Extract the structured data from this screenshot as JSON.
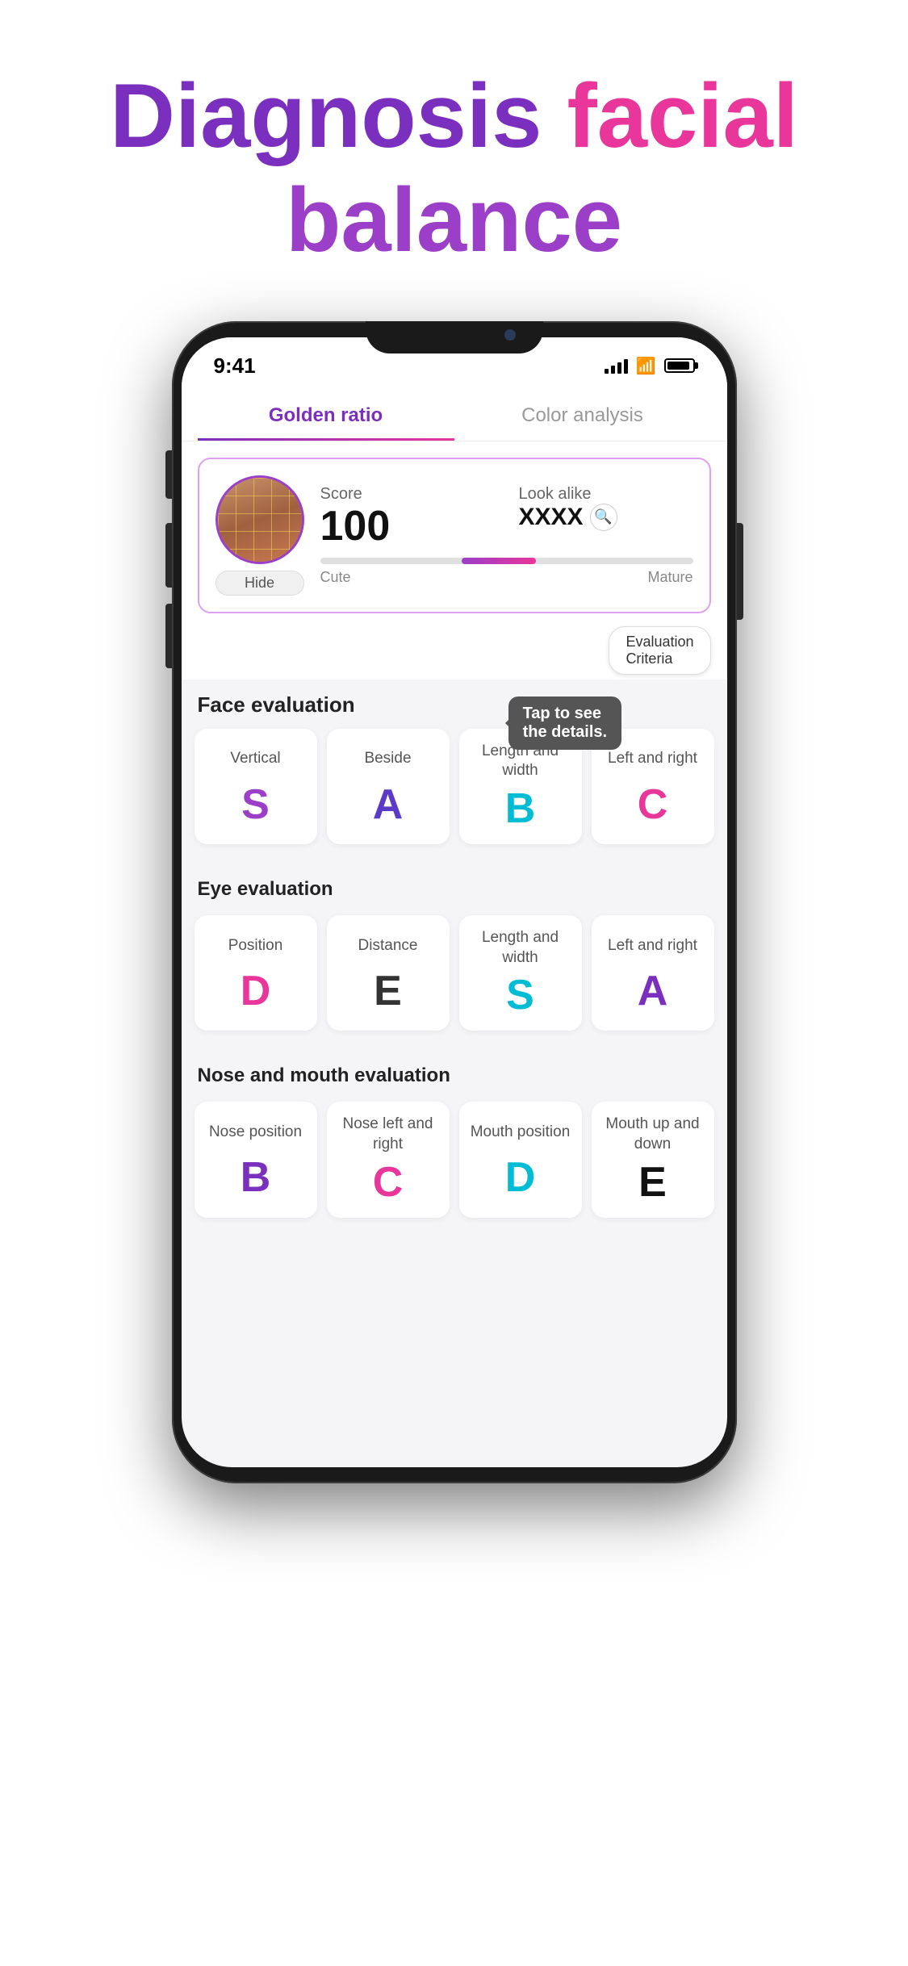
{
  "header": {
    "line1_part1": "Diagnosis ",
    "line1_part2": "facial",
    "line2": "balance"
  },
  "status_bar": {
    "time": "9:41",
    "signal_bars": [
      6,
      10,
      14,
      18
    ],
    "wifi": "wifi",
    "battery": "battery"
  },
  "tabs": [
    {
      "label": "Golden ratio",
      "active": true
    },
    {
      "label": "Color analysis",
      "active": false
    }
  ],
  "score_card": {
    "score_label": "Score",
    "score_value": "100",
    "look_alike_label": "Look alike",
    "look_alike_value": "XXXX",
    "hide_button": "Hide",
    "bar_label_left": "Cute",
    "bar_label_right": "Mature"
  },
  "eval_criteria_button": "Evaluation\nCriteria",
  "tooltip": "Tap to see\nthe details.",
  "face_evaluation": {
    "title": "Face evaluation",
    "cards": [
      {
        "label": "Vertical",
        "grade": "S",
        "grade_class": "grade-s"
      },
      {
        "label": "Beside",
        "grade": "A",
        "grade_class": "grade-a-dark"
      },
      {
        "label": "Length and width",
        "grade": "B",
        "grade_class": "grade-b-cyan"
      },
      {
        "label": "Left and right",
        "grade": "C",
        "grade_class": "grade-c-pink"
      }
    ]
  },
  "eye_evaluation": {
    "title": "Eye evaluation",
    "cards": [
      {
        "label": "Position",
        "grade": "D",
        "grade_class": "grade-d-pink"
      },
      {
        "label": "Distance",
        "grade": "E",
        "grade_class": "grade-e-dark"
      },
      {
        "label": "Length and width",
        "grade": "S",
        "grade_class": "grade-s-cyan"
      },
      {
        "label": "Left and right",
        "grade": "A",
        "grade_class": "grade-a-purple"
      }
    ]
  },
  "nose_mouth_evaluation": {
    "title": "Nose and mouth evaluation",
    "cards": [
      {
        "label": "Nose position",
        "grade": "B",
        "grade_class": "grade-b-purple"
      },
      {
        "label": "Nose left and right",
        "grade": "C",
        "grade_class": "grade-c-pink2"
      },
      {
        "label": "Mouth position",
        "grade": "D",
        "grade_class": "grade-d-teal"
      },
      {
        "label": "Mouth up and down",
        "grade": "E",
        "grade_class": "grade-e-black"
      }
    ]
  }
}
